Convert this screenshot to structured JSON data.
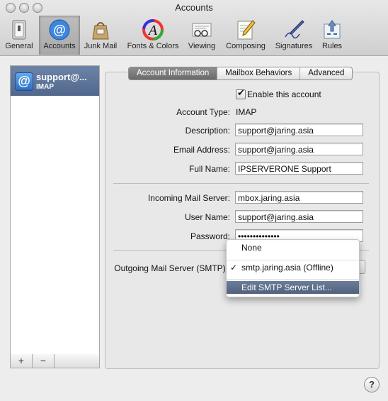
{
  "window": {
    "title": "Accounts"
  },
  "toolbar": {
    "items": [
      {
        "label": "General",
        "icon": "switch-icon"
      },
      {
        "label": "Accounts",
        "icon": "at-sign-icon",
        "selected": true
      },
      {
        "label": "Junk Mail",
        "icon": "junk-mail-bag-icon"
      },
      {
        "label": "Fonts & Colors",
        "icon": "fonts-colors-icon"
      },
      {
        "label": "Viewing",
        "icon": "viewing-glasses-icon"
      },
      {
        "label": "Composing",
        "icon": "composing-pencil-icon"
      },
      {
        "label": "Signatures",
        "icon": "signature-pen-icon"
      },
      {
        "label": "Rules",
        "icon": "rules-arrows-icon"
      }
    ]
  },
  "sidebar": {
    "accounts": [
      {
        "name": "support@...",
        "type": "IMAP"
      }
    ],
    "add_label": "+",
    "remove_label": "−"
  },
  "tabs": [
    {
      "label": "Account Information",
      "active": true
    },
    {
      "label": "Mailbox Behaviors"
    },
    {
      "label": "Advanced"
    }
  ],
  "form": {
    "enable_label": "Enable this account",
    "enable_checked": true,
    "account_type_label": "Account Type:",
    "account_type_value": "IMAP",
    "description_label": "Description:",
    "description_value": "support@jaring.asia",
    "email_label": "Email Address:",
    "email_value": "support@jaring.asia",
    "fullname_label": "Full Name:",
    "fullname_value": "IPSERVERONE Support",
    "incoming_label": "Incoming Mail Server:",
    "incoming_value": "mbox.jaring.asia",
    "username_label": "User Name:",
    "username_value": "support@jaring.asia",
    "password_label": "Password:",
    "password_value": "••••••••••••••",
    "outgoing_label": "Outgoing Mail Server (SMTP):"
  },
  "smtp_menu": {
    "items": [
      {
        "label": "None"
      },
      {
        "label": "smtp.jaring.asia (Offline)",
        "checked": true
      },
      {
        "label": "Edit SMTP Server List...",
        "highlighted": true
      }
    ],
    "check_glyph": "✓"
  },
  "help_label": "?"
}
